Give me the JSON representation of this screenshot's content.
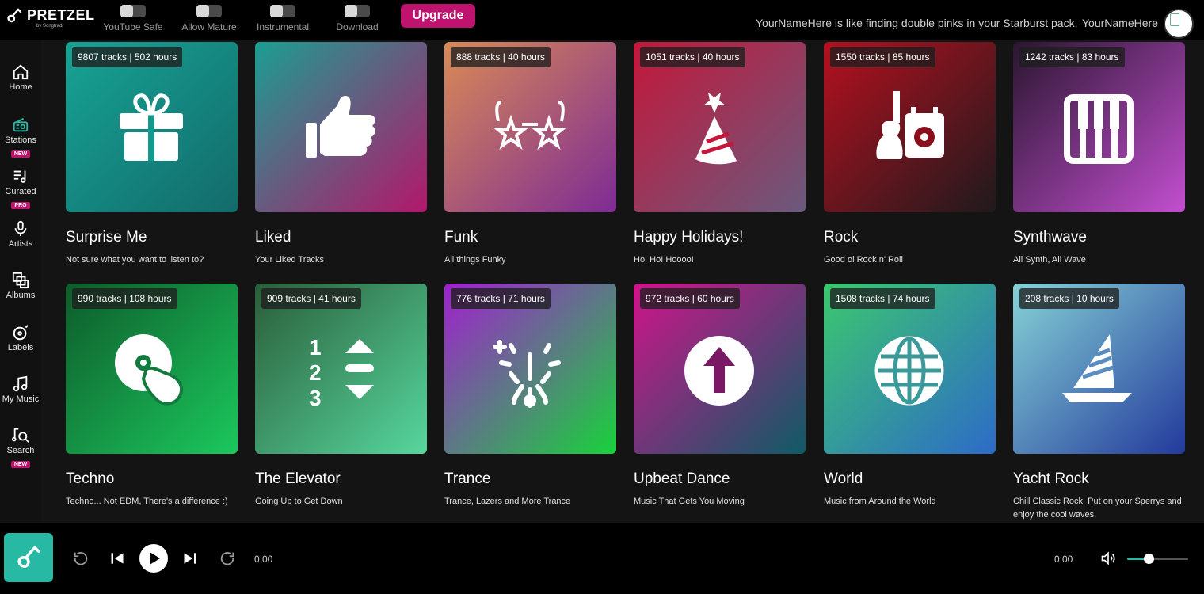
{
  "brand": {
    "name": "PRETZEL",
    "tagline": "by Songtradr"
  },
  "toggles": [
    {
      "label": "YouTube Safe"
    },
    {
      "label": "Allow Mature"
    },
    {
      "label": "Instrumental"
    },
    {
      "label": "Download"
    }
  ],
  "upgrade_label": "Upgrade",
  "header_message": "YourNameHere is like finding double pinks in your Starburst pack.",
  "username": "YourNameHere",
  "nav": [
    {
      "label": "Home",
      "icon": "home-icon"
    },
    {
      "label": "Stations",
      "icon": "radio-icon",
      "badge": "NEW"
    },
    {
      "label": "Curated",
      "icon": "playlist-icon",
      "badge": "PRO"
    },
    {
      "label": "Artists",
      "icon": "microphone-icon"
    },
    {
      "label": "Albums",
      "icon": "albums-icon"
    },
    {
      "label": "Labels",
      "icon": "label-disc-icon"
    },
    {
      "label": "My Music",
      "icon": "music-note-icon"
    },
    {
      "label": "Search",
      "icon": "search-music-icon",
      "badge": "NEW"
    }
  ],
  "stations": [
    {
      "stats": "9807 tracks | 502 hours",
      "title": "Surprise Me",
      "subtitle": "Not sure what you want to listen to?",
      "icon": "gift-icon",
      "gradient": [
        "#16a394",
        "#136b6b"
      ]
    },
    {
      "stats": "",
      "title": "Liked",
      "subtitle": "Your Liked Tracks",
      "icon": "thumbs-up-icon",
      "gradient": [
        "#1b9e92",
        "#b3176b"
      ]
    },
    {
      "stats": "888 tracks | 40 hours",
      "title": "Funk",
      "subtitle": "All things Funky",
      "icon": "star-glasses-icon",
      "gradient": [
        "#d98a55",
        "#7e2b95"
      ]
    },
    {
      "stats": "1051 tracks | 40 hours",
      "title": "Happy Holidays!",
      "subtitle": "Ho! Ho! Hoooo!",
      "icon": "party-hat-icon",
      "gradient": [
        "#c4173a",
        "#6a5a7d"
      ]
    },
    {
      "stats": "1550 tracks | 85 hours",
      "title": "Rock",
      "subtitle": "Good ol Rock n' Roll",
      "icon": "guitar-amp-icon",
      "gradient": [
        "#b5101f",
        "#1e1a1d"
      ]
    },
    {
      "stats": "1242 tracks | 83 hours",
      "title": "Synthwave",
      "subtitle": "All Synth, All Wave",
      "icon": "keyboard-icon",
      "gradient": [
        "#2a1630",
        "#c34fd0"
      ]
    },
    {
      "stats": "990 tracks | 108 hours",
      "title": "Techno",
      "subtitle": "Techno... Not EDM, There's a difference :)",
      "icon": "dj-disc-icon",
      "gradient": [
        "#0e5b2b",
        "#1bc85d"
      ]
    },
    {
      "stats": "909 tracks | 41 hours",
      "title": "The Elevator",
      "subtitle": "Going Up to Get Down",
      "icon": "elevator-icon",
      "gradient": [
        "#2a5d3a",
        "#56d79d"
      ]
    },
    {
      "stats": "776 tracks | 71 hours",
      "title": "Trance",
      "subtitle": "Trance, Lazers and More Trance",
      "icon": "fireworks-icon",
      "gradient": [
        "#a21fd0",
        "#17d33a"
      ]
    },
    {
      "stats": "972 tracks | 60 hours",
      "title": "Upbeat Dance",
      "subtitle": "Music That Gets You Moving",
      "icon": "arrow-up-circle-icon",
      "gradient": [
        "#d1138a",
        "#0e5b66"
      ]
    },
    {
      "stats": "1508 tracks | 74 hours",
      "title": "World",
      "subtitle": "Music from Around the World",
      "icon": "globe-icon",
      "gradient": [
        "#3bc86e",
        "#2d6bc8"
      ]
    },
    {
      "stats": "208 tracks | 10 hours",
      "title": "Yacht Rock",
      "subtitle": "Chill Classic Rock. Put on your Sperrys and enjoy the cool waves.",
      "icon": "sailboat-icon",
      "gradient": [
        "#86d2d6",
        "#233a9c"
      ]
    }
  ],
  "player": {
    "elapsed": "0:00",
    "remaining": "0:00",
    "volume_fraction": 0.35
  },
  "colors": {
    "accent": "#27b9a4",
    "brand_pink": "#c0136f",
    "background": "#141414"
  }
}
